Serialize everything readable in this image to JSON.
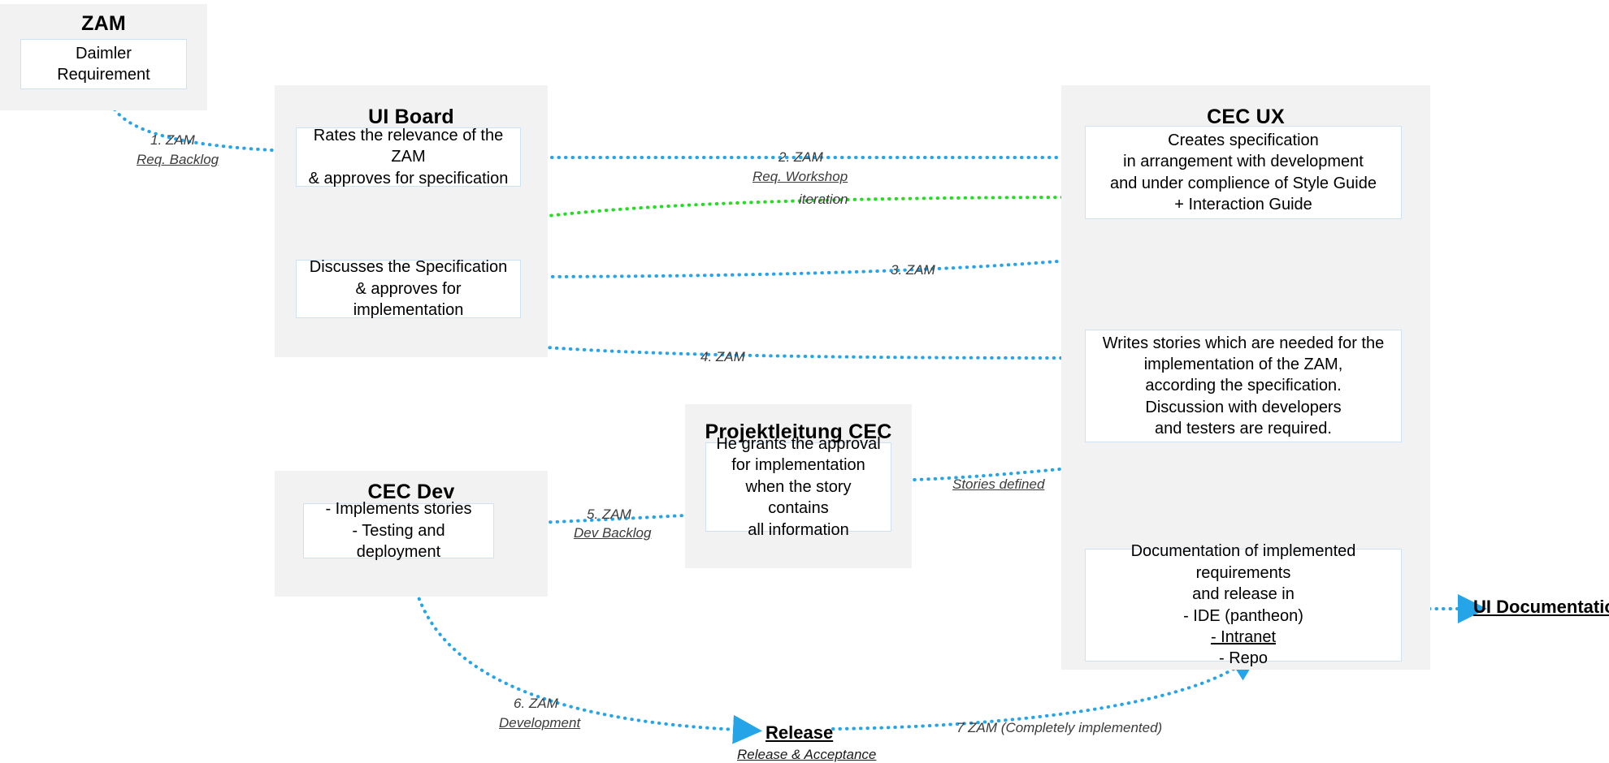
{
  "diagram": {
    "title_visible": false,
    "colors": {
      "panel_bg": "#f2f2f2",
      "box_border": "#cfe2f3",
      "flow_blue": "#26a4e8",
      "flow_green": "#22dd22",
      "text": "#000000"
    }
  },
  "panels": [
    {
      "id": "zam",
      "title": "ZAM"
    },
    {
      "id": "ui_board",
      "title": "UI Board"
    },
    {
      "id": "cec_ux",
      "title": "CEC UX"
    },
    {
      "id": "projektleitung",
      "title": "Projektleitung CEC"
    },
    {
      "id": "cec_dev",
      "title": "CEC Dev"
    }
  ],
  "boxes": {
    "daimler_requirement": "Daimler Requirement",
    "rates_relevance": "Rates the relevance of the ZAM\n& approves for specification",
    "discusses_specification": "Discusses the Specification\n& approves for implementation",
    "creates_specification": "Creates specification\nin arrangement with development\nand under complience of Style Guide\n+ Interaction Guide",
    "writes_stories": "Writes stories which are needed for the\nimplementation of the ZAM,\naccording the specification.\nDiscussion with developers\nand testers are required.",
    "grants_approval": "He grants the approval\nfor implementation\nwhen the story contains\nall information",
    "implements_stories": "- Implements stories\n- Testing and deployment",
    "documentation_line1": "Documentation of implemented requirements",
    "documentation_line2": "and release in",
    "documentation_line3": "- IDE (pantheon)",
    "documentation_line4": "- Intranet",
    "documentation_line5": "- Repo"
  },
  "edges": [
    {
      "id": "e1",
      "label": "1. ZAM",
      "sublabel": "Req. Backlog",
      "color": "#26a4e8"
    },
    {
      "id": "e2",
      "label": "2. ZAM",
      "sublabel": "Req. Workshop",
      "color": "#26a4e8"
    },
    {
      "id": "e_iteration",
      "label": "iteration",
      "sublabel": "",
      "color": "#22dd22"
    },
    {
      "id": "e3",
      "label": "3. ZAM",
      "sublabel": "",
      "color": "#26a4e8"
    },
    {
      "id": "e4",
      "label": "4. ZAM",
      "sublabel": "",
      "color": "#26a4e8"
    },
    {
      "id": "e_stories",
      "label": "Stories defined",
      "sublabel": "",
      "color": "#26a4e8"
    },
    {
      "id": "e5",
      "label": "5. ZAM",
      "sublabel": "Dev Backlog",
      "color": "#26a4e8"
    },
    {
      "id": "e6",
      "label": "6. ZAM",
      "sublabel": "Development",
      "color": "#26a4e8"
    },
    {
      "id": "e7",
      "label": "7 ZAM (Completely implemented)",
      "sublabel": "",
      "color": "#26a4e8"
    }
  ],
  "milestones": {
    "ui_documentation": "UI Documentation",
    "release": "Release",
    "release_sub": "Release & Acceptance"
  }
}
